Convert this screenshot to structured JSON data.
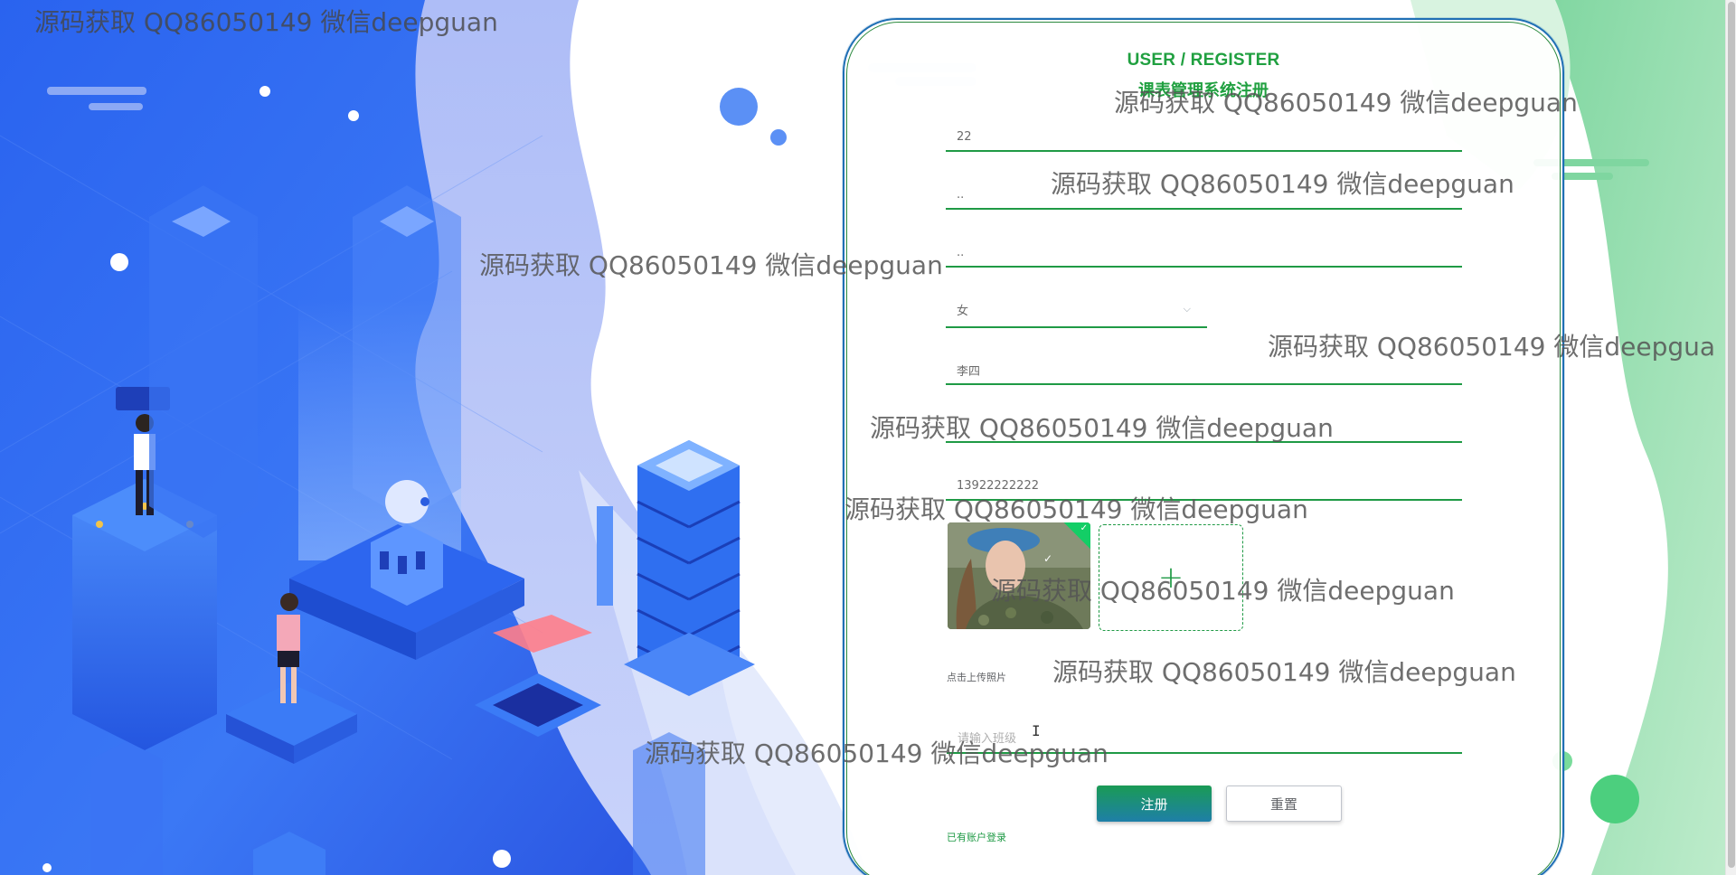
{
  "header": {
    "title_en": "USER / REGISTER",
    "title_cn": "课表管理系统注册"
  },
  "form": {
    "field_1_value": "22",
    "field_2_value": "..",
    "field_3_value": "..",
    "gender_value": "女",
    "name_value": "李四",
    "field_6_value": "",
    "phone_value": "13922222222",
    "upload_tip": "点击上传照片",
    "class_placeholder": "请输入班级"
  },
  "actions": {
    "register_label": "注册",
    "reset_label": "重置",
    "login_link": "已有账户登录"
  },
  "watermark": {
    "text": "源码获取 QQ86050149 微信deepguan",
    "text_cut": "源码获取 QQ86050149 微信deepgua"
  },
  "colors": {
    "accent_green": "#1f9a45",
    "card_border_blue": "#1f6fb5",
    "bg_blue": "#2f6fe8"
  }
}
